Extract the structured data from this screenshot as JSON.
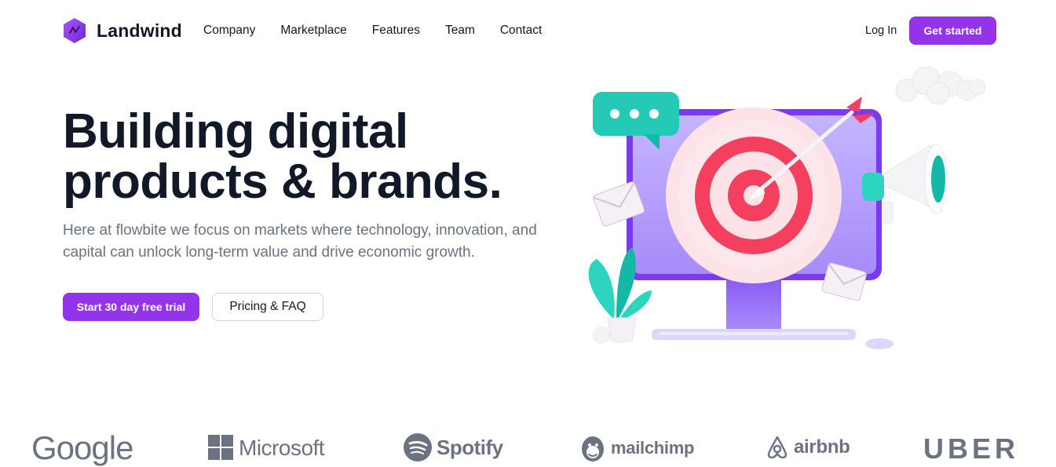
{
  "brand": {
    "name": "Landwind",
    "logo_icon": "hexagon-logo-icon",
    "accent": "#9333ea"
  },
  "nav": {
    "items": [
      {
        "label": "Company"
      },
      {
        "label": "Marketplace"
      },
      {
        "label": "Features"
      },
      {
        "label": "Team"
      },
      {
        "label": "Contact"
      }
    ],
    "login_label": "Log In",
    "get_started_label": "Get started"
  },
  "hero": {
    "title_line1": "Building digital",
    "title_line2": "products & brands.",
    "description": "Here at flowbite we focus on markets where technology, innovation, and capital can unlock long-term value and drive economic growth.",
    "primary_cta": "Start 30 day free trial",
    "secondary_cta": "Pricing & FAQ",
    "illustration_icon": "target-computer-illustration"
  },
  "logos": {
    "google": "Google",
    "microsoft": "Microsoft",
    "spotify": "Spotify",
    "mailchimp": "mailchimp",
    "airbnb": "airbnb",
    "uber": "UBER"
  },
  "colors": {
    "text_dark": "#111827",
    "text_muted": "#6b7280",
    "logo_gray": "#6b7280"
  }
}
